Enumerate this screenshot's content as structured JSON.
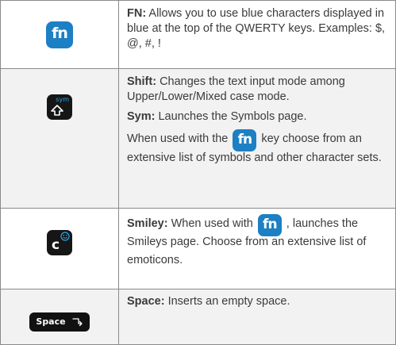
{
  "rows": [
    {
      "key_label": "fn",
      "paragraphs": [
        {
          "term": "FN:",
          "text": " Allows you to use blue characters displayed in blue at the top of the QWERTY keys. Examples: $, @, #, !"
        }
      ]
    },
    {
      "key_label": "sym",
      "shift": {
        "term": "Shift:",
        "text": " Changes the text input mode among Upper/Lower/Mixed case mode."
      },
      "sym": {
        "term": "Sym:",
        "text": " Launches the Symbols page."
      },
      "sym_extra_before": "When used with the",
      "sym_extra_key": "fn",
      "sym_extra_after": "key choose from an extensive list of symbols and other character sets."
    },
    {
      "key_label": "c",
      "term": "Smiley:",
      "text_before": " When used with",
      "inline_key": "fn",
      "text_after": ", launches the Smileys page. Choose from an extensive list of emoticons."
    },
    {
      "key_label": "Space",
      "term": "Space:",
      "text": " Inserts an empty space."
    }
  ],
  "colors": {
    "accent": "#1d7fc4",
    "sym_blue": "#2da4e8",
    "text": "#3b3b3b",
    "alt_row": "#f2f2f2",
    "border": "#8a8a8a"
  },
  "icons": [
    "fn-key-icon",
    "shift-sym-key-icon",
    "smiley-key-icon",
    "space-key-icon",
    "return-arrow-icon"
  ]
}
